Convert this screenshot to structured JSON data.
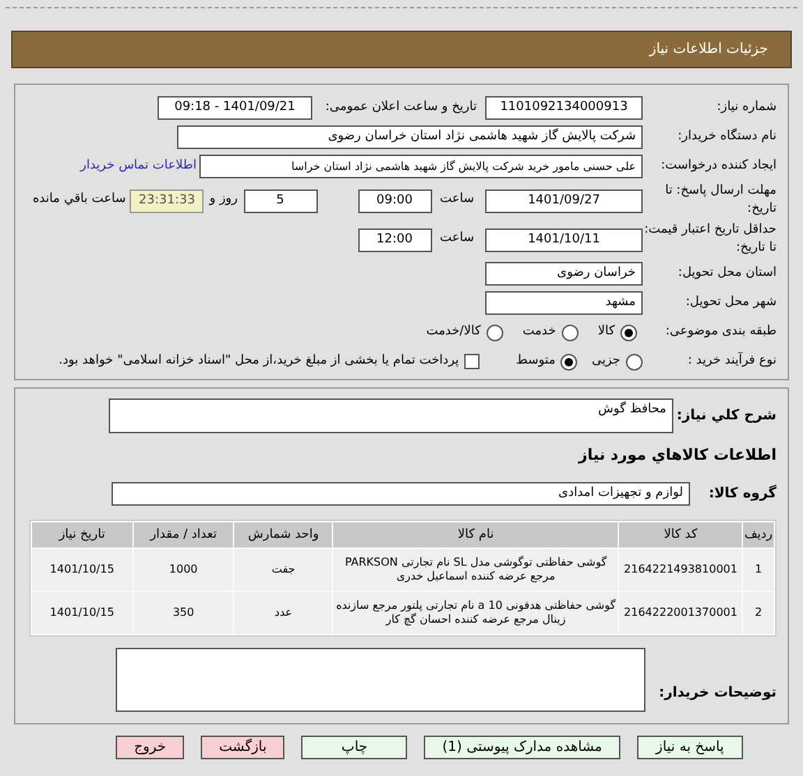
{
  "header": {
    "title": "جزئيات اطلاعات نياز"
  },
  "need_number": {
    "label": "شماره نیاز:",
    "value": "1101092134000913"
  },
  "announce": {
    "label": "تاریخ و ساعت اعلان عمومی:",
    "value": "1401/09/21 - 09:18"
  },
  "buyer": {
    "label": "نام دستگاه خریدار:",
    "value": "شرکت پالایش گاز شهید هاشمی نژاد   استان خراسان رضوی"
  },
  "creator": {
    "label": "ایجاد کننده درخواست:",
    "value": "علی حسنی مامور خرید شرکت پالایش گاز شهید هاشمی نژاد   استان خراسا",
    "link": "اطلاعات تماس خریدار"
  },
  "deadline": {
    "label": "مهلت ارسال پاسخ: تا تاریخ:",
    "date": "1401/09/27",
    "time_label": "ساعت",
    "time": "09:00",
    "days": "5",
    "days_label": "روز و",
    "remaining": "23:31:33",
    "remaining_label": "ساعت باقي مانده"
  },
  "validity": {
    "label": "حداقل تاریخ اعتبار قیمت: تا تاریخ:",
    "date": "1401/10/11",
    "time_label": "ساعت",
    "time": "12:00"
  },
  "province": {
    "label": "استان محل تحویل:",
    "value": "خراسان رضوی"
  },
  "city": {
    "label": "شهر محل تحویل:",
    "value": "مشهد"
  },
  "category": {
    "label": "طبقه بندی موضوعی:",
    "options": [
      {
        "label": "کالا",
        "selected": true
      },
      {
        "label": "خدمت",
        "selected": false
      },
      {
        "label": "کالا/خدمت",
        "selected": false
      }
    ]
  },
  "process": {
    "label": "نوع فرآیند خرید :",
    "options": [
      {
        "label": "جزیی",
        "selected": false
      },
      {
        "label": "متوسط",
        "selected": true
      }
    ],
    "payment": {
      "label": "پرداخت تمام یا بخشی از مبلغ خرید،از محل \"اسناد خزانه اسلامی\" خواهد بود.",
      "checked": false
    }
  },
  "description": {
    "label": "شرح کلي نياز:",
    "value": "محافظ گوش"
  },
  "goods_heading": "اطلاعات كالاهاي مورد نياز",
  "goods_group": {
    "label": "گروه کالا:",
    "value": "لوازم و تجهیزات امدادی"
  },
  "table": {
    "columns": [
      "ردیف",
      "کد کالا",
      "نام کالا",
      "واحد شمارش",
      "تعداد / مقدار",
      "تاریخ نیاز"
    ],
    "rows": [
      [
        "1",
        "2164221493810001",
        "گوشی حفاظتی توگوشی مدل SL نام تجارتی PARKSON مرجع عرضه کننده اسماعیل خدری",
        "جفت",
        "1000",
        "1401/10/15"
      ],
      [
        "2",
        "2164222001370001",
        "گوشی حفاظتی هدفونی 10 a نام تجارتی پلتور مرجع سازنده زینال مرجع عرضه کننده احسان گچ کار",
        "عدد",
        "350",
        "1401/10/15"
      ]
    ]
  },
  "notes": {
    "label": "توضیحات خریدار:"
  },
  "buttons": [
    {
      "label": "پاسخ به نیاز",
      "kind": "normal"
    },
    {
      "label": "مشاهده مدارک پیوستی (1)",
      "kind": "normal"
    },
    {
      "label": "چاپ",
      "kind": "normal"
    },
    {
      "label": "بازگشت",
      "kind": "danger"
    },
    {
      "label": "خروج",
      "kind": "danger"
    }
  ]
}
